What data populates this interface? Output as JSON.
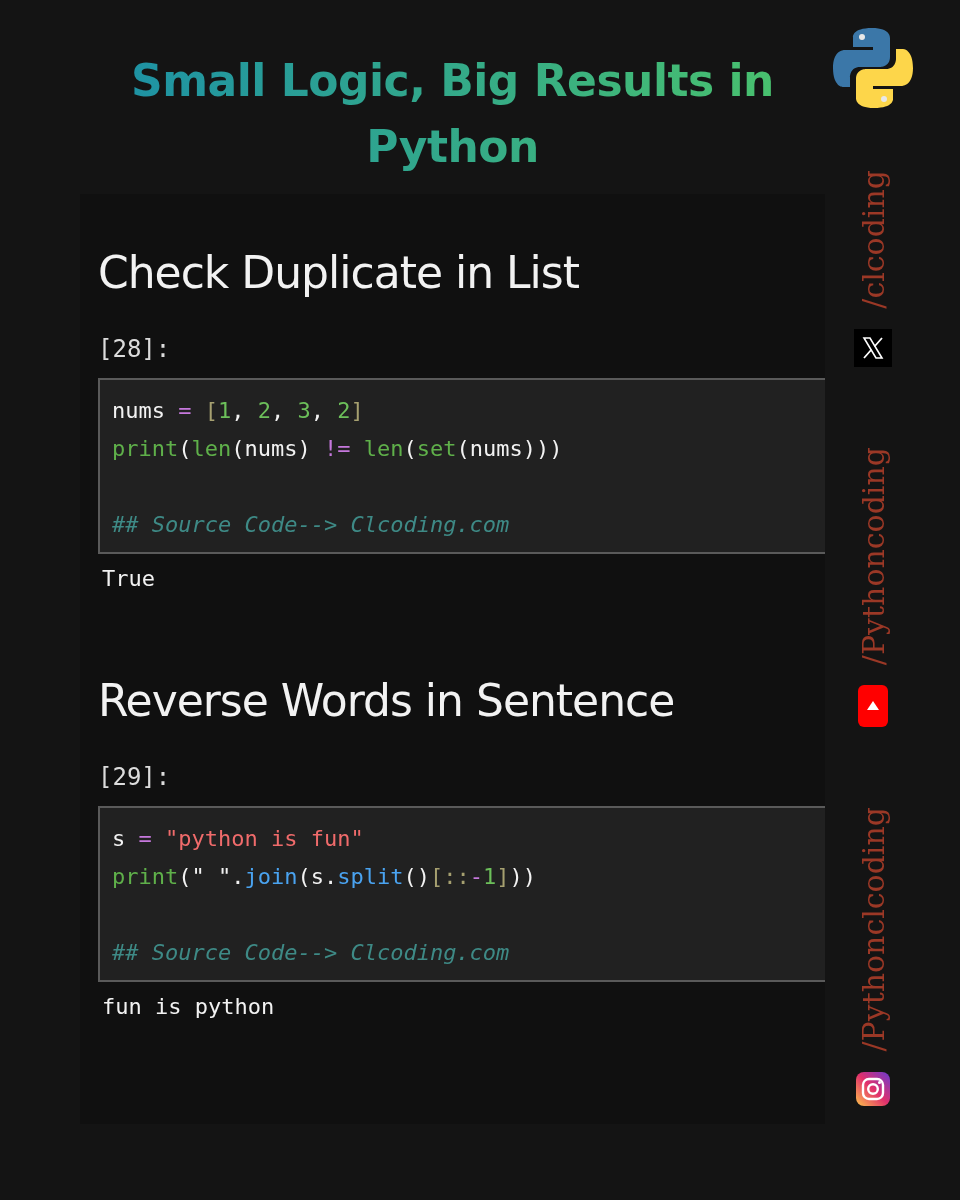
{
  "title": "Small Logic, Big Results in Python",
  "cells": [
    {
      "heading": "Check Duplicate in List",
      "prompt": "[28]:",
      "code": [
        [
          {
            "kind": "name",
            "text": "nums "
          },
          {
            "kind": "op",
            "text": "="
          },
          {
            "kind": "bracket",
            "text": " ["
          },
          {
            "kind": "num",
            "text": "1"
          },
          {
            "kind": "name",
            "text": ", "
          },
          {
            "kind": "num",
            "text": "2"
          },
          {
            "kind": "name",
            "text": ", "
          },
          {
            "kind": "num",
            "text": "3"
          },
          {
            "kind": "name",
            "text": ", "
          },
          {
            "kind": "num",
            "text": "2"
          },
          {
            "kind": "bracket",
            "text": "]"
          }
        ],
        [
          {
            "kind": "builtin",
            "text": "print"
          },
          {
            "kind": "name",
            "text": "("
          },
          {
            "kind": "builtin",
            "text": "len"
          },
          {
            "kind": "name",
            "text": "(nums) "
          },
          {
            "kind": "op",
            "text": "!="
          },
          {
            "kind": "builtin",
            "text": " len"
          },
          {
            "kind": "name",
            "text": "("
          },
          {
            "kind": "builtin",
            "text": "set"
          },
          {
            "kind": "name",
            "text": "(nums)))"
          }
        ],
        [
          {
            "kind": "comment",
            "text": "## Source Code--> Clcoding.com"
          }
        ]
      ],
      "output": "True"
    },
    {
      "heading": "Reverse Words in Sentence",
      "prompt": "[29]:",
      "code": [
        [
          {
            "kind": "name",
            "text": "s "
          },
          {
            "kind": "op",
            "text": "="
          },
          {
            "kind": "string",
            "text": " \"python is fun\""
          }
        ],
        [
          {
            "kind": "builtin",
            "text": "print"
          },
          {
            "kind": "name",
            "text": "(\" \"."
          },
          {
            "kind": "method",
            "text": "join"
          },
          {
            "kind": "name",
            "text": "(s."
          },
          {
            "kind": "method",
            "text": "split"
          },
          {
            "kind": "name",
            "text": "()"
          },
          {
            "kind": "bracket",
            "text": "[::"
          },
          {
            "kind": "op",
            "text": "-"
          },
          {
            "kind": "num",
            "text": "1"
          },
          {
            "kind": "bracket",
            "text": "]"
          },
          {
            "kind": "name",
            "text": "))"
          }
        ],
        [
          {
            "kind": "comment",
            "text": "## Source Code--> Clcoding.com"
          }
        ]
      ],
      "output": "fun is python"
    }
  ],
  "social": [
    {
      "kind": "x",
      "handle": "/clcoding"
    },
    {
      "kind": "youtube",
      "handle": "/Pythoncoding"
    },
    {
      "kind": "instagram",
      "handle": "/Pythonclcoding"
    }
  ]
}
